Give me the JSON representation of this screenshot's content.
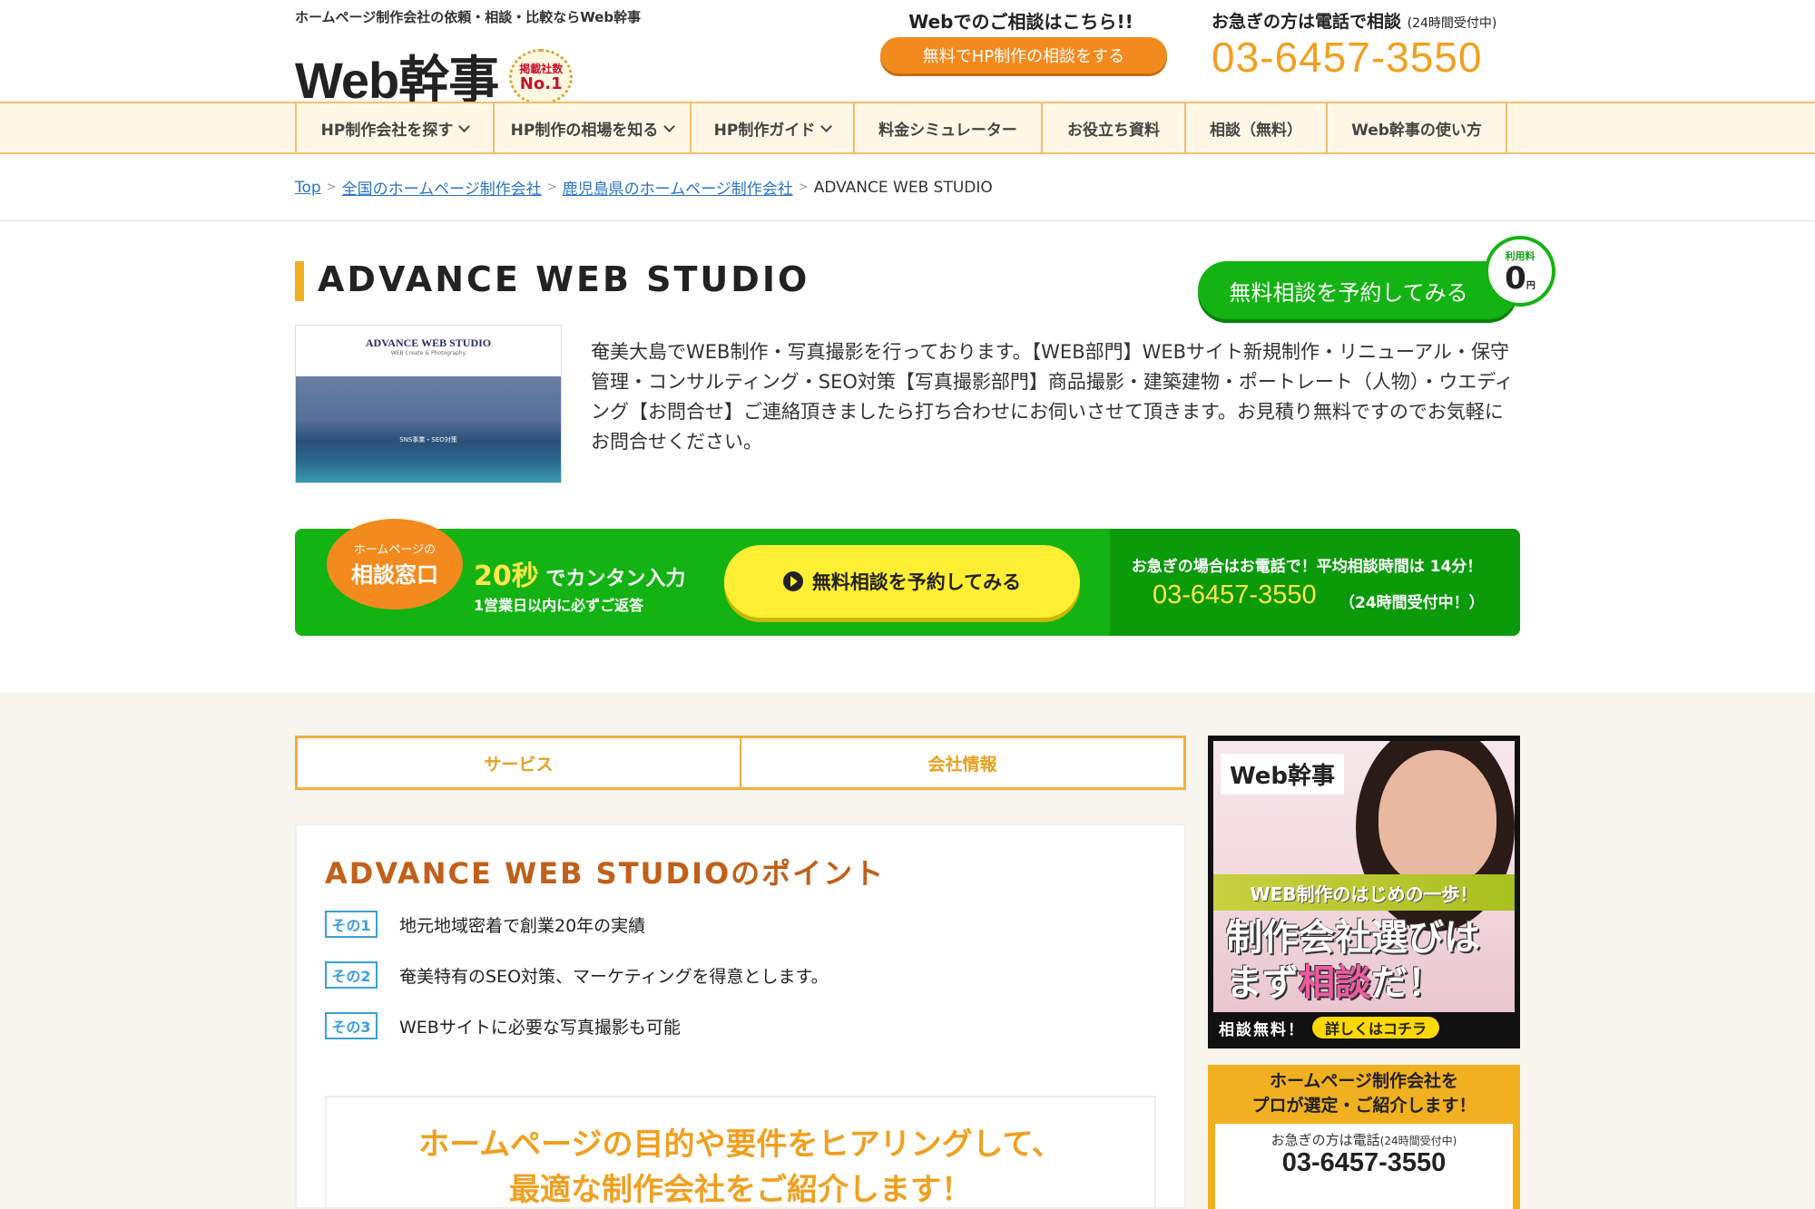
{
  "header": {
    "tagline": "ホームページ制作会社の依頼・相談・比較ならWeb幹事",
    "logo_text": "Web幹事",
    "badge_line1": "掲載社数",
    "badge_line2": "No.1",
    "web_consult_label": "Webでのご相談はこちら!!",
    "web_consult_button": "無料でHP制作の相談をする",
    "phone_label": "お急ぎの方は電話で相談",
    "phone_note": "(24時間受付中)",
    "phone_number": "03-6457-3550"
  },
  "nav": {
    "items": [
      {
        "label": "HP制作会社を探す",
        "dropdown": true
      },
      {
        "label": "HP制作の相場を知る",
        "dropdown": true
      },
      {
        "label": "HP制作ガイド",
        "dropdown": true
      },
      {
        "label": "料金シミュレーター",
        "dropdown": false
      },
      {
        "label": "お役立ち資料",
        "dropdown": false
      },
      {
        "label": "相談（無料）",
        "dropdown": false
      },
      {
        "label": "Web幹事の使い方",
        "dropdown": false
      }
    ]
  },
  "breadcrumb": {
    "items": [
      "Top",
      "全国のホームページ制作会社",
      "鹿児島県のホームページ制作会社"
    ],
    "current": "ADVANCE WEB STUDIO"
  },
  "company": {
    "name": "ADVANCE WEB STUDIO",
    "reserve_button": "無料相談を予約してみる",
    "fee_label": "利用料",
    "fee_value": "0",
    "fee_unit": "円",
    "thumb_title": "ADVANCE WEB STUDIO",
    "thumb_subtitle": "WEB Create & Photography",
    "thumb_caption": "SNS事業・SEO対策",
    "description": "奄美大島でWEB制作・写真撮影を行っております。【WEB部門】WEBサイト新規制作・リニューアル・保守管理・コンサルティング・SEO対策【写真撮影部門】商品撮影・建築建物・ポートレート（人物）・ウエディング【お問合せ】ご連絡頂きましたら打ち合わせにお伺いさせて頂きます。お見積り無料ですのでお気軽にお問合せください。"
  },
  "cta": {
    "badge_small": "ホームページの",
    "badge_big": "相談窓口",
    "seconds": "20秒",
    "easy_input": "でカンタン入力",
    "reply_note": "1営業日以内に必ずご返答",
    "button": "無料相談を予約してみる",
    "phone_label": "お急ぎの場合はお電話で！平均相談時間は 14分！",
    "phone_number": "03-6457-3550",
    "phone_note": "（24時間受付中！）"
  },
  "tabs": [
    "サービス",
    "会社情報"
  ],
  "points": {
    "title": "ADVANCE WEB STUDIOのポイント",
    "items": [
      {
        "tag": "その1",
        "text": "地元地域密着で創業20年の実績"
      },
      {
        "tag": "その2",
        "text": "奄美特有のSEO対策、マーケティングを得意とします。"
      },
      {
        "tag": "その3",
        "text": "WEBサイトに必要な写真撮影も可能"
      }
    ]
  },
  "hearing": {
    "line1": "ホームページの目的や要件をヒアリングして、",
    "line2": "最適な制作会社をご紹介します！"
  },
  "banner": {
    "logo": "Web幹事",
    "strip": "WEB制作のはじめの一歩！",
    "big_line1": "制作会社選びは",
    "big_line2a": "まず",
    "big_line2b": "相談",
    "big_line2c": "だ！",
    "free": "相談無料！",
    "detail": "詳しくはコチラ"
  },
  "side_box": {
    "title_line1": "ホームページ制作会社を",
    "title_line2": "プロが選定・ご紹介します！",
    "label": "お急ぎの方は電話",
    "label_note": "(24時間受付中)",
    "phone": "03-6457-3550"
  },
  "colors": {
    "orange": "#f28a1d",
    "green": "#12b312",
    "yellow": "#ffee33",
    "gold": "#f0b020",
    "link": "#2a74c0"
  }
}
